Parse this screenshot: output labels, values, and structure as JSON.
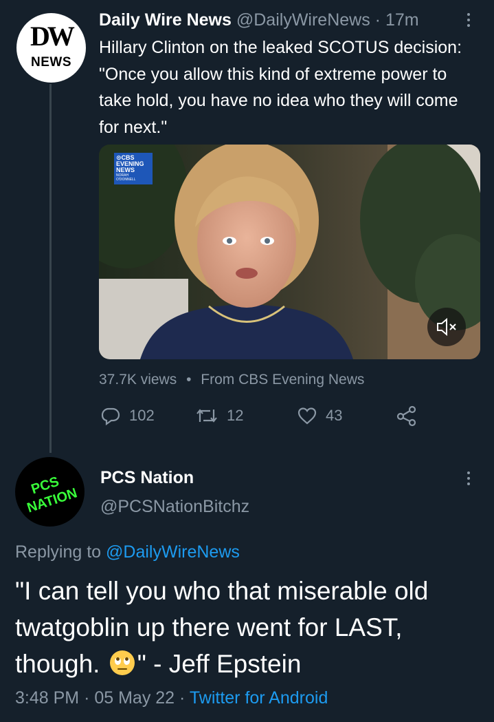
{
  "parent_tweet": {
    "avatar": {
      "line1": "DW",
      "line2": "NEWS"
    },
    "display_name": "Daily Wire News",
    "handle": "@DailyWireNews",
    "separator": "·",
    "time_ago": "17m",
    "text": "Hillary Clinton on the leaked SCOTUS decision: \"Once you allow this kind of extreme power to take hold, you have no idea who they will come for next.\"",
    "media": {
      "logo_line1": "⊙CBS",
      "logo_line2": "EVENING",
      "logo_line3": "NEWS",
      "logo_line4": "NORAH",
      "logo_line5": "O'DONNELL",
      "mute_icon": "speaker-muted-icon"
    },
    "views": "37.7K views",
    "views_dot": "•",
    "source": "From CBS Evening News",
    "actions": {
      "replies": "102",
      "retweets": "12",
      "likes": "43"
    }
  },
  "reply_tweet": {
    "avatar": {
      "line1": "PCS",
      "line2": "NATION",
      "accent": "#39ff3a"
    },
    "display_name": "PCS Nation",
    "handle": "@PCSNationBitchz",
    "replying_prefix": "Replying to",
    "replying_to": "@DailyWireNews",
    "text_part1": "\"I can tell you who that miserable old twatgoblin up there went for LAST, though.",
    "emoji": "face-with-rolling-eyes",
    "text_part2": "\" - Jeff Epstein",
    "time": "3:48 PM",
    "meta_separator": "·",
    "date": "05 May 22",
    "client": "Twitter for Android"
  },
  "colors": {
    "background": "#15202b",
    "muted": "#8b98a5",
    "link": "#1d9bf0",
    "thread_line": "#38444d"
  }
}
